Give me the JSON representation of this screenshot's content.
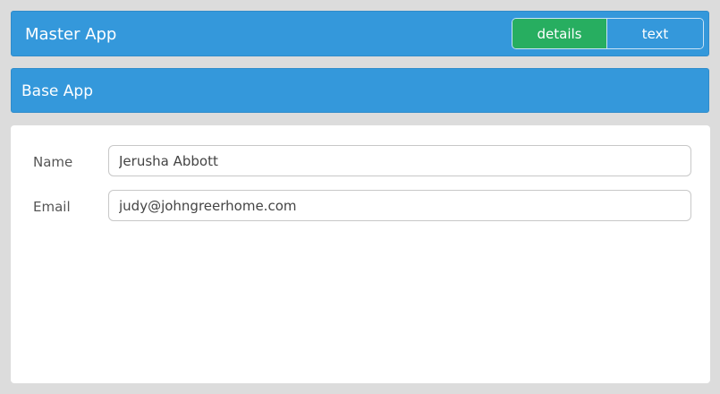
{
  "master": {
    "title": "Master App",
    "segments": [
      {
        "label": "details",
        "active": true
      },
      {
        "label": "text",
        "active": false
      }
    ]
  },
  "base": {
    "title": "Base App"
  },
  "form": {
    "fields": [
      {
        "label": "Name",
        "value": "Jerusha Abbott"
      },
      {
        "label": "Email",
        "value": "judy@johngreerhome.com"
      }
    ]
  },
  "colors": {
    "header_blue": "#3498db",
    "active_green": "#27ae60",
    "background": "#dcdcdc"
  }
}
